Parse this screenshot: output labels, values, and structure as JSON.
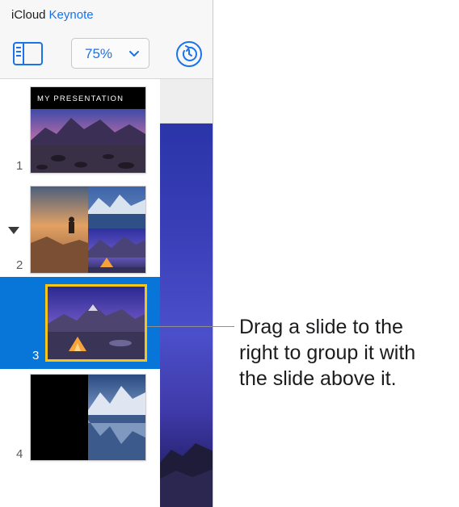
{
  "app": {
    "brand_prefix": "iCloud",
    "brand_name": "Keynote",
    "accent": "#1a73e8"
  },
  "toolbar": {
    "navigator_icon": "sidebar-toggle-icon",
    "zoom_value": "75%",
    "zoom_icon": "chevron-down-icon",
    "history_icon": "history-icon"
  },
  "slides": [
    {
      "number": "1",
      "title": "MY PRESENTATION"
    },
    {
      "number": "2"
    },
    {
      "number": "3",
      "selected": true,
      "selection_color": "#0875d9",
      "border_color": "#f5c518"
    },
    {
      "number": "4"
    }
  ],
  "callout": {
    "line1": "Drag a slide to the",
    "line2": "right to group it with",
    "line3": "the slide above it."
  }
}
